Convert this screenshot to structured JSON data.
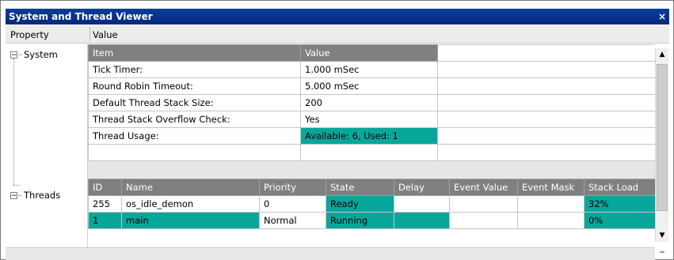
{
  "window": {
    "title": "System and Thread Viewer",
    "close_glyph": "×"
  },
  "columns": {
    "property": "Property",
    "value": "Value"
  },
  "tree": {
    "system_label": "System",
    "threads_label": "Threads",
    "expand_glyph": "−"
  },
  "system_table": {
    "headers": {
      "item": "Item",
      "value": "Value"
    },
    "rows": [
      {
        "item": "Tick Timer:",
        "value": "1.000 mSec"
      },
      {
        "item": "Round Robin Timeout:",
        "value": "5.000 mSec"
      },
      {
        "item": "Default Thread Stack Size:",
        "value": "200"
      },
      {
        "item": "Thread Stack Overflow Check:",
        "value": "Yes"
      },
      {
        "item": "Thread Usage:",
        "value": "Available: 6, Used: 1"
      }
    ]
  },
  "threads_table": {
    "headers": {
      "id": "ID",
      "name": "Name",
      "priority": "Priority",
      "state": "State",
      "delay": "Delay",
      "event_value": "Event Value",
      "event_mask": "Event Mask",
      "stack_load": "Stack Load"
    },
    "rows": [
      {
        "id": "255",
        "name": "os_idle_demon",
        "priority": "0",
        "state": "Ready",
        "delay": "",
        "event_value": "",
        "event_mask": "",
        "stack_load": "32%"
      },
      {
        "id": "1",
        "name": "main",
        "priority": "Normal",
        "state": "Running",
        "delay": "",
        "event_value": "",
        "event_mask": "",
        "stack_load": "0%"
      }
    ]
  },
  "colors": {
    "highlight": "#08a79c",
    "header": "#808080",
    "titlebar": "#0a3d9c"
  },
  "icons": {
    "scroll_up": "scroll-up-arrow-icon",
    "scroll_down": "scroll-down-arrow-icon",
    "expand": "minus-box-icon"
  }
}
